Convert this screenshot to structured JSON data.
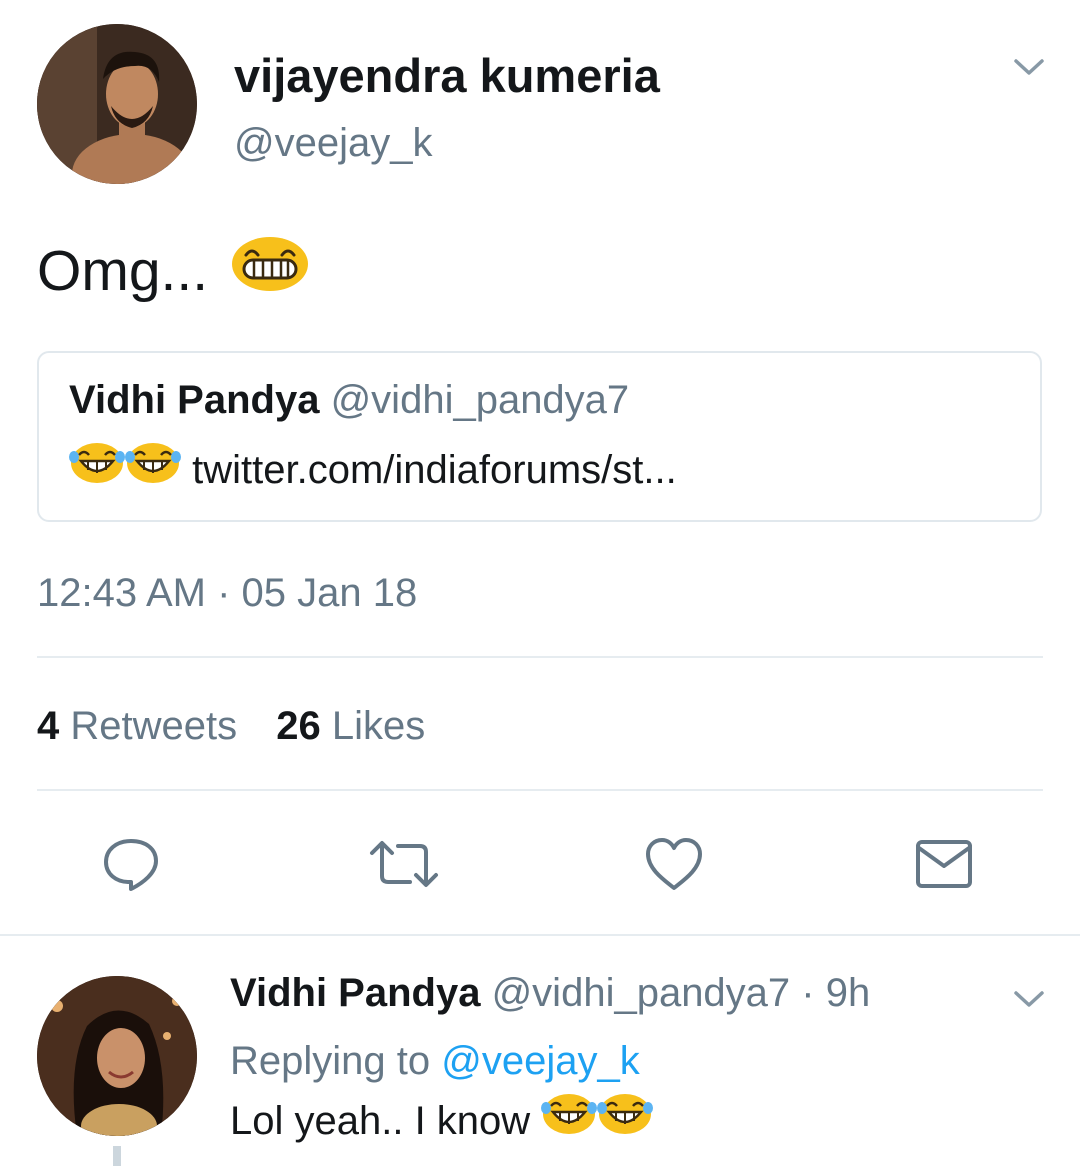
{
  "tweet": {
    "author_name": "vijayendra kumeria",
    "author_handle": "@veejay_k",
    "text": "Omg...",
    "text_emoji": "grinning-face-emoji",
    "quoted": {
      "name": "Vidhi Pandya",
      "handle": "@vidhi_pandya7",
      "emojis": [
        "face-with-tears-of-joy-emoji",
        "face-with-tears-of-joy-emoji"
      ],
      "link": "twitter.com/indiaforums/st..."
    },
    "timestamp": "12:43 AM · 05 Jan 18",
    "stats": {
      "retweets_count": "4",
      "retweets_label": "Retweets",
      "likes_count": "26",
      "likes_label": "Likes"
    },
    "actions": [
      "reply-icon",
      "retweet-icon",
      "like-icon",
      "direct-message-icon"
    ]
  },
  "reply": {
    "author_name": "Vidhi Pandya",
    "author_handle": "@vidhi_pandya7",
    "time": "· 9h",
    "replying_prefix": "Replying to",
    "replying_handle": "@veejay_k",
    "text": "Lol yeah.. I know",
    "emojis": [
      "face-with-tears-of-joy-emoji",
      "face-with-tears-of-joy-emoji"
    ]
  },
  "colors": {
    "text": "#14171a",
    "secondary": "#657786",
    "accent": "#1da1f2",
    "divider": "#e6ecf0",
    "emoji": "#f7c01b"
  }
}
